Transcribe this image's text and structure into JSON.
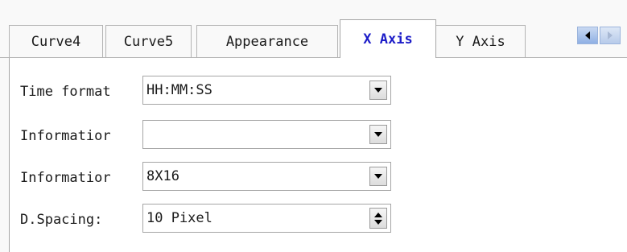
{
  "tabs": [
    {
      "id": "curve4",
      "label": "Curve4",
      "active": false
    },
    {
      "id": "curve5",
      "label": "Curve5",
      "active": false
    },
    {
      "id": "appearance",
      "label": "Appearance",
      "active": false
    },
    {
      "id": "x-axis",
      "label": "X Axis",
      "active": true
    },
    {
      "id": "y-axis",
      "label": "Y Axis",
      "active": false
    }
  ],
  "tab_scroller": {
    "left_icon": "triangle-left-icon",
    "right_icon": "triangle-right-icon"
  },
  "form": {
    "time_format": {
      "label": "Time format",
      "value": "HH:MM:SS",
      "control": "dropdown"
    },
    "information_1": {
      "label": "Informatior",
      "value": "",
      "control": "dropdown"
    },
    "information_2": {
      "label": "Informatior",
      "value": "8X16",
      "control": "dropdown"
    },
    "d_spacing": {
      "label": "D.Spacing:",
      "value": "10 Pixel",
      "control": "spinner"
    }
  },
  "colors": {
    "active_tab_text": "#1c1cc8",
    "panel_background": "#ffffff",
    "window_background": "#f9f9f9",
    "border": "#a5a5a5"
  }
}
